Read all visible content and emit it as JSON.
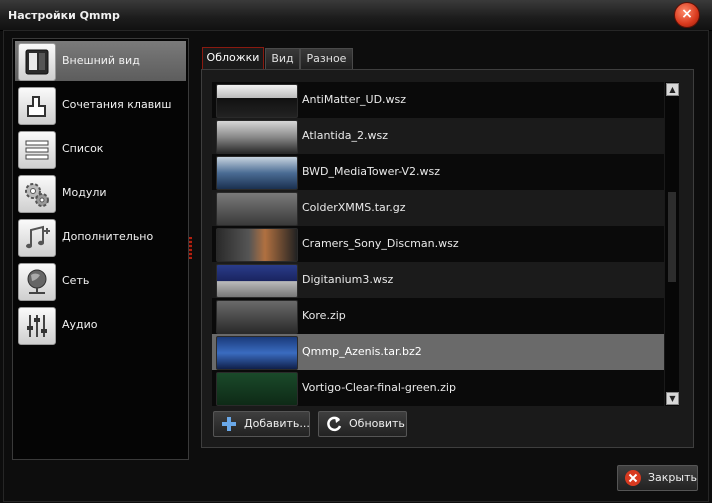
{
  "window": {
    "title": "Настройки Qmmp",
    "close_glyph": "×"
  },
  "sidebar": {
    "items": [
      {
        "label": "Внешний вид",
        "icon": "appearance-icon",
        "selected": true
      },
      {
        "label": "Сочетания клавиш",
        "icon": "keyboard-shortcuts-icon"
      },
      {
        "label": "Список",
        "icon": "list-icon"
      },
      {
        "label": "Модули",
        "icon": "gears-icon"
      },
      {
        "label": "Дополнительно",
        "icon": "music-note-plus-icon"
      },
      {
        "label": "Сеть",
        "icon": "globe-network-icon"
      },
      {
        "label": "Аудио",
        "icon": "mixer-sliders-icon"
      }
    ]
  },
  "tabs": [
    {
      "label": "Обложки",
      "active": true
    },
    {
      "label": "Вид"
    },
    {
      "label": "Разное"
    }
  ],
  "skins": [
    {
      "name": "AntiMatter_UD.wsz"
    },
    {
      "name": "Atlantida_2.wsz"
    },
    {
      "name": "BWD_MediaTower-V2.wsz"
    },
    {
      "name": "ColderXMMS.tar.gz"
    },
    {
      "name": "Cramers_Sony_Discman.wsz"
    },
    {
      "name": "Digitanium3.wsz"
    },
    {
      "name": "Kore.zip"
    },
    {
      "name": "Qmmp_Azenis.tar.bz2",
      "selected": true
    },
    {
      "name": "Vortigo-Clear-final-green.zip"
    }
  ],
  "buttons": {
    "add": "Добавить...",
    "refresh": "Обновить",
    "close": "Закрыть"
  },
  "colors": {
    "accent": "#b32010",
    "selection": "#6a6a6a"
  }
}
